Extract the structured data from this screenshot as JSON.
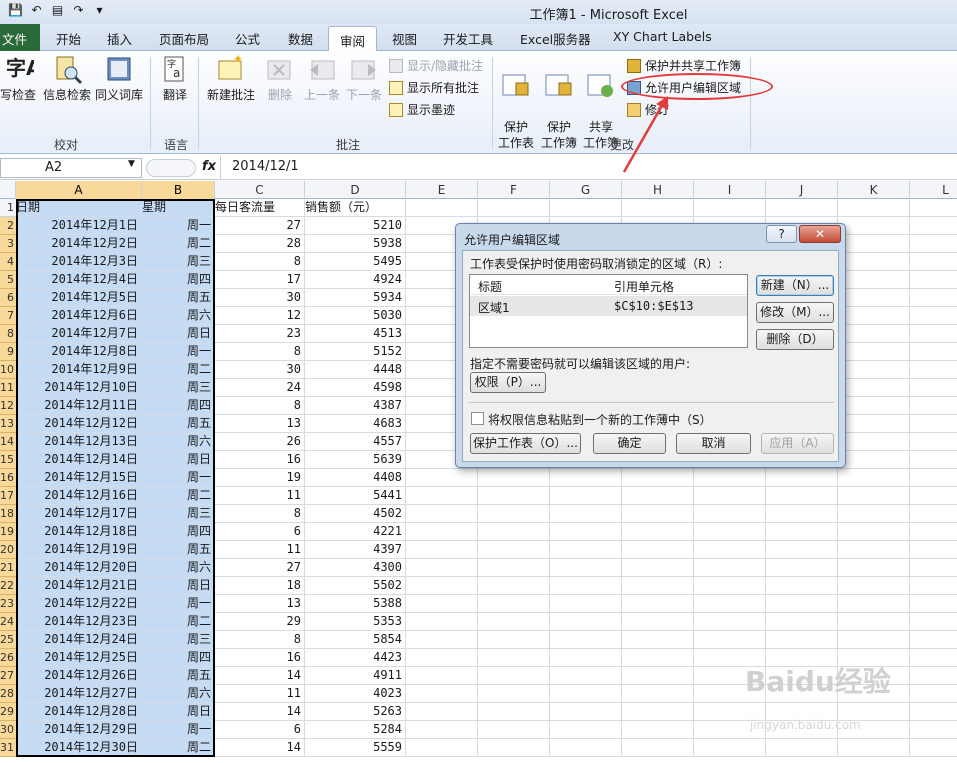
{
  "window_title": "工作簿1 - Microsoft Excel",
  "tabs": {
    "file": "文件",
    "home": "开始",
    "insert": "插入",
    "page_layout": "页面布局",
    "formulas": "公式",
    "data": "数据",
    "review": "审阅",
    "view": "视图",
    "developer": "开发工具",
    "excel_services": "Excel服务器",
    "xy_chart": "XY Chart Labels"
  },
  "ribbon": {
    "proofing": {
      "spell": "写检查",
      "research": "信息检索",
      "thesaurus": "同义词库",
      "label": "校对"
    },
    "language": {
      "translate": "翻译",
      "label": "语言"
    },
    "comments": {
      "new": "新建批注",
      "delete": "删除",
      "prev": "上一条",
      "next": "下一条",
      "show_hide": "显示/隐藏批注",
      "show_all": "显示所有批注",
      "show_ink": "显示墨迹",
      "label": "批注"
    },
    "changes": {
      "protect_sheet": "保护\n工作表",
      "protect_workbook": "保护\n工作簿",
      "share_workbook": "共享\n工作簿",
      "protect_share": "保护并共享工作簿",
      "allow_edit": "允许用户编辑区域",
      "track": "修订",
      "label": "更改"
    }
  },
  "formula_bar": {
    "name_box": "A2",
    "fx": "fx",
    "value": "2014/12/1"
  },
  "columns": [
    "A",
    "B",
    "C",
    "D",
    "E",
    "F",
    "G",
    "H",
    "I",
    "J",
    "K",
    "L"
  ],
  "header_row": {
    "row": "1",
    "a": "日期",
    "b": "星期",
    "c": "每日客流量",
    "d": "销售额（元）"
  },
  "rows": [
    {
      "r": "2",
      "a": "2014年12月1日",
      "b": "周一",
      "c": "27",
      "d": "5210"
    },
    {
      "r": "3",
      "a": "2014年12月2日",
      "b": "周二",
      "c": "28",
      "d": "5938"
    },
    {
      "r": "4",
      "a": "2014年12月3日",
      "b": "周三",
      "c": "8",
      "d": "5495"
    },
    {
      "r": "5",
      "a": "2014年12月4日",
      "b": "周四",
      "c": "17",
      "d": "4924"
    },
    {
      "r": "6",
      "a": "2014年12月5日",
      "b": "周五",
      "c": "30",
      "d": "5934"
    },
    {
      "r": "7",
      "a": "2014年12月6日",
      "b": "周六",
      "c": "12",
      "d": "5030"
    },
    {
      "r": "8",
      "a": "2014年12月7日",
      "b": "周日",
      "c": "23",
      "d": "4513"
    },
    {
      "r": "9",
      "a": "2014年12月8日",
      "b": "周一",
      "c": "8",
      "d": "5152"
    },
    {
      "r": "10",
      "a": "2014年12月9日",
      "b": "周二",
      "c": "30",
      "d": "4448"
    },
    {
      "r": "11",
      "a": "2014年12月10日",
      "b": "周三",
      "c": "24",
      "d": "4598"
    },
    {
      "r": "12",
      "a": "2014年12月11日",
      "b": "周四",
      "c": "8",
      "d": "4387"
    },
    {
      "r": "13",
      "a": "2014年12月12日",
      "b": "周五",
      "c": "13",
      "d": "4683"
    },
    {
      "r": "14",
      "a": "2014年12月13日",
      "b": "周六",
      "c": "26",
      "d": "4557"
    },
    {
      "r": "15",
      "a": "2014年12月14日",
      "b": "周日",
      "c": "16",
      "d": "5639"
    },
    {
      "r": "16",
      "a": "2014年12月15日",
      "b": "周一",
      "c": "19",
      "d": "4408"
    },
    {
      "r": "17",
      "a": "2014年12月16日",
      "b": "周二",
      "c": "11",
      "d": "5441"
    },
    {
      "r": "18",
      "a": "2014年12月17日",
      "b": "周三",
      "c": "8",
      "d": "4502"
    },
    {
      "r": "19",
      "a": "2014年12月18日",
      "b": "周四",
      "c": "6",
      "d": "4221"
    },
    {
      "r": "20",
      "a": "2014年12月19日",
      "b": "周五",
      "c": "11",
      "d": "4397"
    },
    {
      "r": "21",
      "a": "2014年12月20日",
      "b": "周六",
      "c": "27",
      "d": "4300"
    },
    {
      "r": "22",
      "a": "2014年12月21日",
      "b": "周日",
      "c": "18",
      "d": "5502"
    },
    {
      "r": "23",
      "a": "2014年12月22日",
      "b": "周一",
      "c": "13",
      "d": "5388"
    },
    {
      "r": "24",
      "a": "2014年12月23日",
      "b": "周二",
      "c": "29",
      "d": "5353"
    },
    {
      "r": "25",
      "a": "2014年12月24日",
      "b": "周三",
      "c": "8",
      "d": "5854"
    },
    {
      "r": "26",
      "a": "2014年12月25日",
      "b": "周四",
      "c": "16",
      "d": "4423"
    },
    {
      "r": "27",
      "a": "2014年12月26日",
      "b": "周五",
      "c": "14",
      "d": "4911"
    },
    {
      "r": "28",
      "a": "2014年12月27日",
      "b": "周六",
      "c": "11",
      "d": "4023"
    },
    {
      "r": "29",
      "a": "2014年12月28日",
      "b": "周日",
      "c": "14",
      "d": "5263"
    },
    {
      "r": "30",
      "a": "2014年12月29日",
      "b": "周一",
      "c": "6",
      "d": "5284"
    },
    {
      "r": "31",
      "a": "2014年12月30日",
      "b": "周二",
      "c": "14",
      "d": "5559"
    }
  ],
  "dialog": {
    "title": "允许用户编辑区域",
    "help": "?",
    "close": "✕",
    "ranges_label": "工作表受保护时使用密码取消锁定的区域（R）:",
    "col_title": "标题",
    "col_ref": "引用单元格",
    "range_title": "区域1",
    "range_ref": "$C$10:$E$13",
    "new_btn": "新建（N）...",
    "modify_btn": "修改（M）...",
    "delete_btn": "删除（D）",
    "users_label": "指定不需要密码就可以编辑该区域的用户:",
    "perm_btn": "权限（P）...",
    "paste_label": "将权限信息粘贴到一个新的工作薄中（S）",
    "protect_btn": "保护工作表（O）...",
    "ok_btn": "确定",
    "cancel_btn": "取消",
    "apply_btn": "应用（A）"
  },
  "watermark": {
    "brand": "Baidu经验",
    "url": "jingyan.baidu.com"
  },
  "colors": {
    "selection": "#c5dbf3",
    "row_header_sel": "#f9d99a",
    "file_tab": "#2a6a38",
    "annotation": "#e23b3b"
  }
}
